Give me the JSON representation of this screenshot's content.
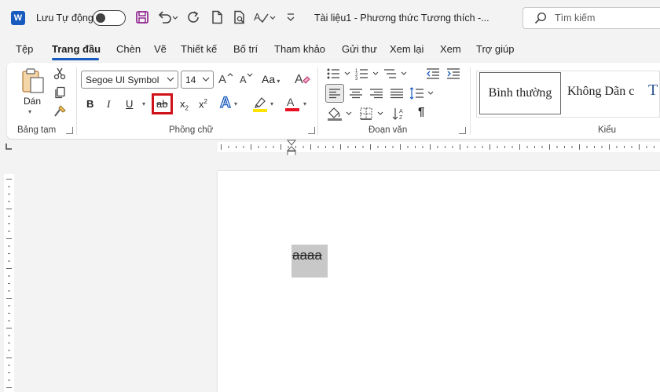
{
  "titlebar": {
    "app_logo": "W",
    "autosave_label": "Lưu Tự động",
    "autosave_state": "off",
    "doc_title": "Tài liệu1  -  Phương thức Tương thích  -...",
    "search_placeholder": "Tìm kiếm",
    "icons": [
      "save-icon",
      "undo-icon",
      "redo-icon",
      "new-doc-icon",
      "print-preview-icon",
      "spelling-icon",
      "customize-qat-icon"
    ]
  },
  "tabs": [
    {
      "label": "Tệp",
      "active": false
    },
    {
      "label": "Trang đầu",
      "active": true
    },
    {
      "label": "Chèn",
      "active": false
    },
    {
      "label": "Vẽ",
      "active": false
    },
    {
      "label": "Thiết kế",
      "active": false
    },
    {
      "label": "Bố trí",
      "active": false
    },
    {
      "label": "Tham khảo",
      "active": false
    },
    {
      "label": "Gửi thư",
      "active": false
    },
    {
      "label": "Xem lại",
      "active": false
    },
    {
      "label": "Xem",
      "active": false
    },
    {
      "label": "Trợ giúp",
      "active": false
    }
  ],
  "ribbon": {
    "clipboard": {
      "group_label": "Bảng tạm",
      "paste_label": "Dán"
    },
    "font": {
      "group_label": "Phông chữ",
      "font_name": "Segoe UI Symbol",
      "font_size": "14",
      "case_label": "Aa",
      "bold": "B",
      "italic": "I",
      "underline": "U",
      "strike": "ab",
      "subscript": "x",
      "subscript_mark": "2",
      "superscript": "x",
      "superscript_mark": "2",
      "text_effects": "A",
      "font_color": "A"
    },
    "paragraph": {
      "group_label": "Đoạn văn",
      "pilcrow": "¶"
    },
    "styles": {
      "group_label": "Kiểu",
      "items": [
        "Bình thường",
        "Không Dãn c",
        "T"
      ]
    }
  },
  "colors": {
    "accent": "#185abd",
    "highlight_box": "#d0131a",
    "highlight_yellow": "#ffe400",
    "font_red": "#e81123",
    "selection": "#c8c8c8"
  },
  "document": {
    "text": "aaaa",
    "formatting": "strikethrough"
  }
}
